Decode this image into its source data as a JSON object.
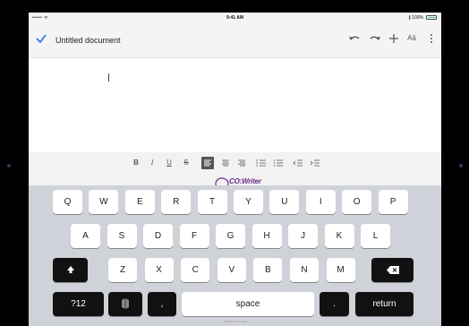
{
  "status": {
    "signal": "•••••  ᯤ",
    "time": "9:41 AM",
    "battery": "∦ 100%"
  },
  "toolbar": {
    "doc_title": "Untitled document",
    "text_format_label": "Aā"
  },
  "format_bar": {
    "bold": "B",
    "italic": "I",
    "underline": "U",
    "strike": "S"
  },
  "cowriter": {
    "name": "CO:Writer",
    "sub": "Universal"
  },
  "keyboard": {
    "row1": [
      "Q",
      "W",
      "E",
      "R",
      "T",
      "Y",
      "U",
      "I",
      "O",
      "P"
    ],
    "row2": [
      "A",
      "S",
      "D",
      "F",
      "G",
      "H",
      "J",
      "K",
      "L"
    ],
    "row3": [
      "Z",
      "X",
      "C",
      "V",
      "B",
      "N",
      "M"
    ],
    "numbers_label": "?12",
    "comma": ",",
    "space_label": "space",
    "period": ".",
    "return_label": "return",
    "hint": "Co:Writer Universal"
  }
}
